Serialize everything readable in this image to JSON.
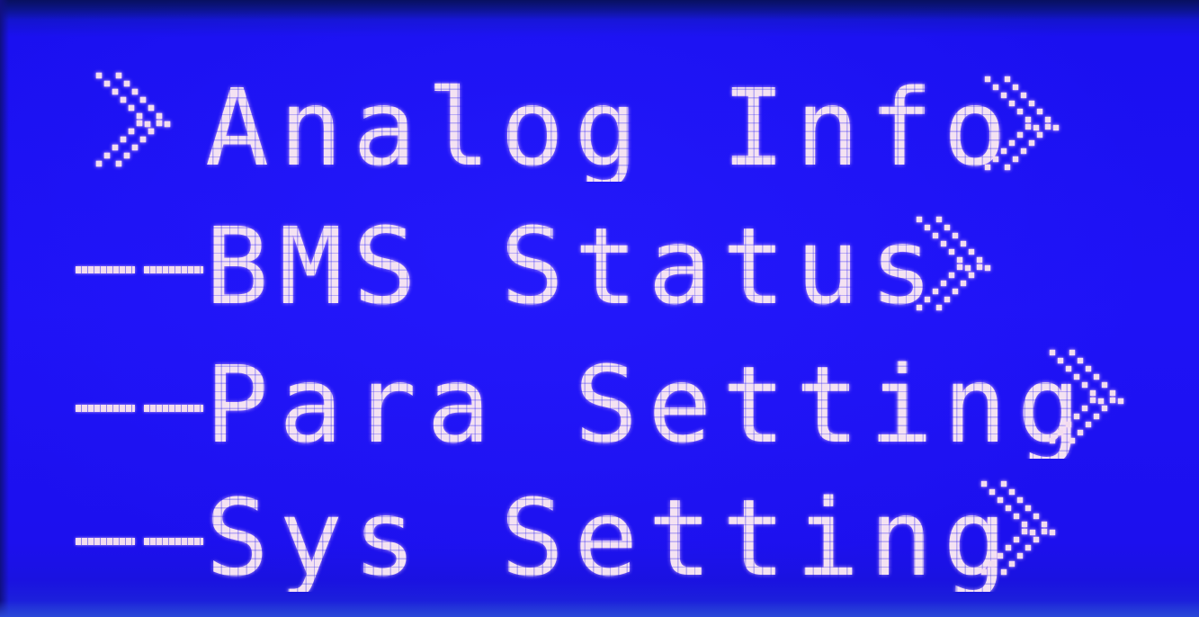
{
  "screen": {
    "background_color": "#1e12f6",
    "text_color": "#f4e2f2"
  },
  "menu": {
    "selected_index": 0,
    "items": [
      {
        "label": "Analog Info",
        "selected": true,
        "marker": "chevron-double-right-icon"
      },
      {
        "label": "BMS Status",
        "selected": false,
        "marker": "dash-prefix"
      },
      {
        "label": "Para Setting",
        "selected": false,
        "marker": "dash-prefix"
      },
      {
        "label": "Sys Setting",
        "selected": false,
        "marker": "dash-prefix"
      }
    ]
  }
}
